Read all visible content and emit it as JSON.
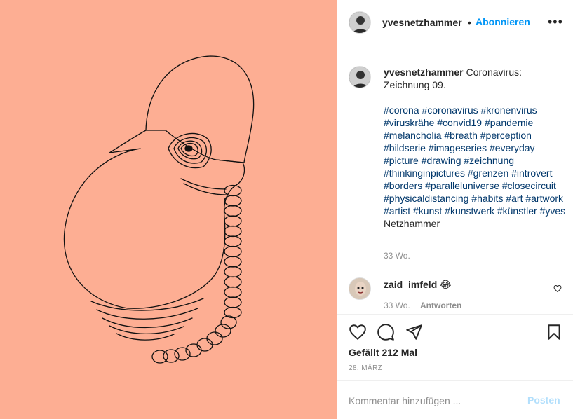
{
  "post": {
    "username": "yvesnetzhammer",
    "follow_separator": "•",
    "follow_label": "Abonnieren",
    "more_label": "•••"
  },
  "caption": {
    "username": "yvesnetzhammer",
    "text": "Coronavirus: Zeichnung 09.",
    "hashtags": "#corona #coronavirus #kronenvirus #viruskrähe #convid19 #pandemie #melancholia #breath #perception #bildserie #imageseries #everyday #picture #drawing #zeichnung #thinkinginpictures #grenzen #introvert #borders #paralleluniverse #closecircuit #physicaldistancing #habits #art #artwork #artist #kunst #kunstwerk #künstler #yves",
    "trailing": "Netzhammer",
    "time": "33 Wo."
  },
  "comment": {
    "username": "zaid_imfeld",
    "emoji": "😂",
    "time": "33 Wo.",
    "reply_label": "Antworten"
  },
  "stats": {
    "likes": "Gefällt 212 Mal",
    "date": "28. MÄRZ"
  },
  "comment_input": {
    "placeholder": "Kommentar hinzufügen ...",
    "post_label": "Posten"
  },
  "colors": {
    "image_background": "#fdae93",
    "link": "#0095f6",
    "hashtag": "#00376b",
    "muted": "#8e8e8e"
  },
  "icons": [
    "heart-icon",
    "comment-icon",
    "share-icon",
    "bookmark-icon",
    "more-icon"
  ]
}
